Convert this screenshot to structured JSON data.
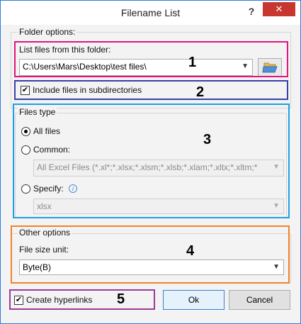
{
  "window": {
    "title": "Filename List",
    "help_label": "?",
    "close_label": "✕"
  },
  "folder_options": {
    "group_title": "Folder options:",
    "list_files_label": "List files from this folder:",
    "folder_path": "C:\\Users\\Mars\\Desktop\\test files\\",
    "folder_browse_icon": "folder-open-icon",
    "include_subdirs_label": "Include files in subdirectories",
    "include_subdirs_checked": true
  },
  "files_type": {
    "group_title": "Files type",
    "all_files_label": "All files",
    "common_label": "Common:",
    "common_value": "All Excel Files (*.xl*;*.xlsx;*.xlsm;*.xlsb;*.xlam;*.xltx;*.xltm;*",
    "specify_label": "Specify:",
    "specify_value": "xlsx",
    "selected": "All files"
  },
  "other_options": {
    "group_title": "Other options",
    "file_size_unit_label": "File size unit:",
    "file_size_unit_value": "Byte(B)"
  },
  "footer": {
    "create_hyperlinks_label": "Create hyperlinks",
    "create_hyperlinks_checked": true,
    "ok_label": "Ok",
    "cancel_label": "Cancel"
  },
  "annotations": {
    "n1": "1",
    "n2": "2",
    "n3": "3",
    "n4": "4",
    "n5": "5",
    "colors": {
      "box1": "#e4157d",
      "box2": "#3b3fa8",
      "box3": "#1ba1e2",
      "box4": "#f0822a",
      "box5": "#9b3c98"
    }
  }
}
